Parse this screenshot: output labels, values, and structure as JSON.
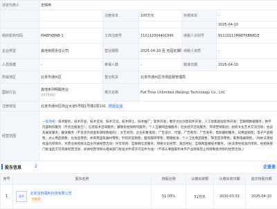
{
  "rows": {
    "legal_rep_label": "法定代表人",
    "legal_rep_value": "史晴冉",
    "registered_capital_label": "注册资本",
    "registered_capital_value": "100万元",
    "paid_capital_label": "实缴资本",
    "paid_capital_value": "-",
    "date_value_top": "2025-04-10",
    "org_code_label": "组织机构代码",
    "org_code_value": "MAEFKBNB-1",
    "business_reg_label": "工商注册号",
    "business_reg_value": "110112004401990",
    "taxpayer_id_label": "纳税人识别号",
    "taxpayer_id_value": "91110112MAEFKBNB1E",
    "company_type_label": "企业类型",
    "company_type_value": "其他有限责任公司",
    "operating_period_label": "营业期限",
    "operating_period_value": "2025-04-10 至 无固定期限",
    "taxpayer_qual_label": "纳税人资质",
    "taxpayer_qual_value": "-",
    "staff_label": "人员规模",
    "staff_value": "-",
    "insured_label": "参保人数",
    "insured_value": "-",
    "approval_date_label": "核准日期",
    "approval_date_value": "2025-04-10",
    "region_label": "所属地区",
    "region_value": "北京市通州区",
    "authority_label": "登记机关",
    "authority_value": "北京市通州区市场监督管理局",
    "industry_label": "国标行业",
    "industry_value_line1": "其他未列明服务业",
    "industry_value_line2": "(M7590)",
    "english_name_label": "英文名称",
    "english_name_value": "Full Time Unlimited (Beijing) Technology Co., Ltd.",
    "address_label": "注册地址",
    "address_value": "北京市通州区商业大道5号院1号楼2层101",
    "address_tag": "附近企业",
    "scope_label": "经营范围",
    "scope_value": "一般项目：技术服务、技术开发、技术咨询、技术交流、技术转让、技术推广；软件开发；数字文化创意软件开发；人工智能基础软件开发；互联网数据服务；数字内容制作服务（不含出版发行）；信息技术咨询服务；摄像及视频制作服务；个人互联网直播服务；社会经济咨询服务；市场营销策划；组织文化艺术交流活动；会议及展览服务；翻译服务（不含涉外调查和测绘数据的）；文艺创作；企业形象策划；广告设计、代理；广告制作；广告发布；电影摄制服务；日用品销售；电子产品销售；办公用品销售；化妆品零售；体育用品及器材零售；针纺织品销售；服装服饰零售；鞋帽批发；个人卫生用品销售；珠宝首饰零售；家用电器销售。（除依法须经批准的项目外，凭营业执照依法自主开展经营活动）许可项目：互联网信息服务；网络文化经营；演出经纪；互联网直播技术服务。（依法须经批准的项目，经相关部门批准后方可开展经营活动，具体经营项目以相关部门批准文件或许可证件为准）（不得从事国家和本市产业政策禁止和限制类项目的经营活动。）",
    "scope_blue_prefix": "一般项目"
  },
  "shareholders": {
    "section_title": "股东信息",
    "count": "2",
    "tyc_logo": "企查查",
    "headers": [
      "序号",
      "股东名称",
      "持股比例",
      "认缴出资额",
      "认缴出资日期",
      "首次持股日期"
    ],
    "row1": {
      "index": "1",
      "logo_text": "北京",
      "name": "北京宝时福利科技有限公司",
      "badge": "大股东",
      "ratio": "51.00%",
      "amount": "51万元",
      "date1": "2030-03-31",
      "date2": "2025-04-10"
    }
  },
  "colors": {
    "accent": "#2b6de5",
    "label_bg": "#f3f6fb",
    "border": "#e8ecf3"
  }
}
